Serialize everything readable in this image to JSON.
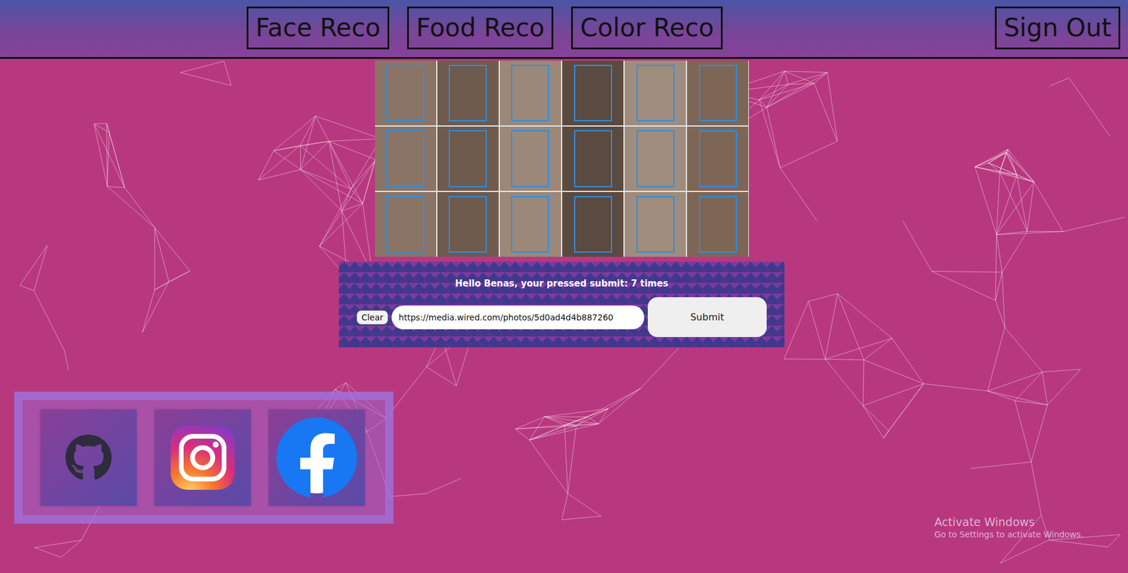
{
  "nav": {
    "items": [
      {
        "label": "Face Reco",
        "selected": false
      },
      {
        "label": "Food Reco",
        "selected": false
      },
      {
        "label": "Color Reco",
        "selected": false
      }
    ],
    "sign_out": "Sign Out"
  },
  "image": {
    "detected_faces": 18
  },
  "form": {
    "greeting": "Hello Benas, your pressed submit: 7 times",
    "clear": "Clear",
    "url_value": "https://media.wired.com/photos/5d0ad4d4b887260",
    "submit": "Submit"
  },
  "social": [
    {
      "kind": "github"
    },
    {
      "kind": "instagram"
    },
    {
      "kind": "facebook"
    }
  ],
  "watermark": {
    "title": "Activate Windows",
    "subtitle": "Go to Settings to activate Windows."
  }
}
